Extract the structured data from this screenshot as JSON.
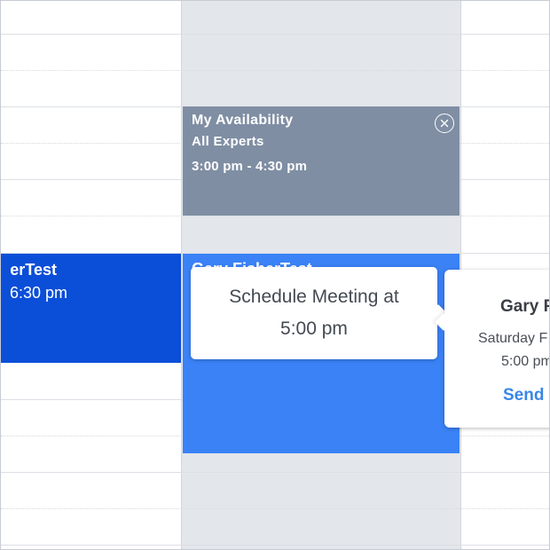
{
  "colors": {
    "highlight_column": "#e3e6eb",
    "availability_block": "#7f8ea3",
    "event_dark_blue": "#0b4ed8",
    "event_blue": "#3a82f6",
    "link_blue": "#3a86e8"
  },
  "events": {
    "availability": {
      "title": "My Availability",
      "subtitle": "All Experts",
      "time": "3:00 pm - 4:30 pm",
      "close_icon": "close-circle-icon"
    },
    "left_event": {
      "title": "erTest",
      "time": "6:30 pm"
    },
    "middle_event": {
      "title": "Gary FisherTest"
    }
  },
  "schedule_tooltip": {
    "line1": "Schedule Meeting at",
    "line2": "5:00 pm"
  },
  "detail_popover": {
    "name": "Gary F",
    "date": "Saturday F",
    "time": "5:00 pm",
    "action": "Send"
  }
}
